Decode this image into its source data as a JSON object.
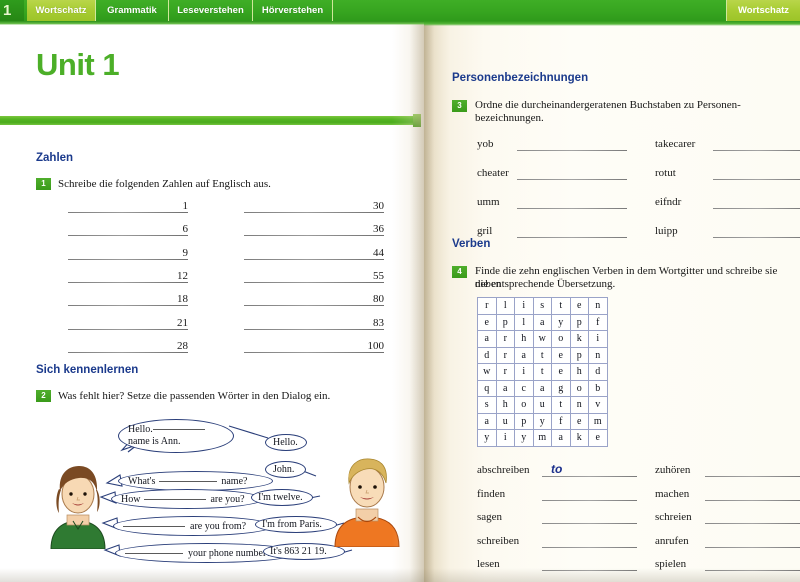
{
  "tabbar": {
    "unit_number": "1",
    "tabs": [
      {
        "label": "Wortschatz",
        "active": true
      },
      {
        "label": "Grammatik",
        "active": false
      },
      {
        "label": "Leseverstehen",
        "active": false
      },
      {
        "label": "Hörverstehen",
        "active": false
      },
      {
        "label": "",
        "active": false
      }
    ],
    "right_tab": "Wortschatz"
  },
  "left_page": {
    "unit_title": "Unit 1",
    "sections": [
      {
        "heading": "Zahlen",
        "exercise_number": "1",
        "instruction": "Schreibe die folgenden Zahlen auf Englisch aus.",
        "numbers_left": [
          "1",
          "6",
          "9",
          "12",
          "18",
          "21",
          "28"
        ],
        "numbers_right": [
          "30",
          "36",
          "44",
          "55",
          "80",
          "83",
          "100"
        ]
      },
      {
        "heading": "Sich kennenlernen",
        "exercise_number": "2",
        "instruction": "Was fehlt hier? Setze die passenden Wörter in den Dialog ein."
      }
    ],
    "dialogue": {
      "bubbles": [
        {
          "id": "b1",
          "speaker": "girl",
          "text_before": "Hello.",
          "text_line2_before": "",
          "text_after": "name is Ann."
        },
        {
          "id": "b2",
          "speaker": "boy",
          "text_before": "Hello."
        },
        {
          "id": "b3",
          "speaker": "boy",
          "text_before": "John."
        },
        {
          "id": "b4",
          "speaker": "girl",
          "text_before": "What's",
          "text_after": "name?"
        },
        {
          "id": "b5",
          "speaker": "girl",
          "text_before": "How",
          "text_after": "are you?"
        },
        {
          "id": "b6",
          "speaker": "boy",
          "text_before": "I'm twelve."
        },
        {
          "id": "b7",
          "speaker": "girl",
          "text_before": "",
          "text_after": "are you from?"
        },
        {
          "id": "b8",
          "speaker": "boy",
          "text_before": "I'm from Paris."
        },
        {
          "id": "b9",
          "speaker": "girl",
          "text_before": "",
          "text_after": "your phone number?"
        },
        {
          "id": "b10",
          "speaker": "boy",
          "text_before": "It's 863 21 19."
        }
      ],
      "characters": [
        {
          "name": "girl-ann",
          "shirt_color": "#2f7a32",
          "hair_color": "#7a4a23"
        },
        {
          "name": "boy-john",
          "shirt_color": "#ee7722",
          "hair_color": "#d8b45c"
        }
      ]
    }
  },
  "right_page": {
    "sections": [
      {
        "heading": "Personenbezeichnungen",
        "exercise_number": "3",
        "instruction_line1": "Ordne die durcheinandergeratenen Buchstaben zu Personen-",
        "instruction_line2": "bezeichnungen.",
        "words_left": [
          "yob",
          "cheater",
          "umm",
          "gril"
        ],
        "words_right": [
          "takecarer",
          "rotut",
          "eifndr",
          "luipp"
        ]
      },
      {
        "heading": "Verben",
        "exercise_number": "4",
        "instruction_line1": "Finde die zehn englischen Verben in dem Wortgitter und schreibe sie neben",
        "instruction_line2": "die entsprechende Übersetzung.",
        "letter_grid": [
          [
            "r",
            "l",
            "i",
            "s",
            "t",
            "e",
            "n"
          ],
          [
            "e",
            "p",
            "l",
            "a",
            "y",
            "p",
            "f"
          ],
          [
            "a",
            "r",
            "h",
            "w",
            "o",
            "k",
            "i"
          ],
          [
            "d",
            "r",
            "a",
            "t",
            "e",
            "p",
            "n"
          ],
          [
            "w",
            "r",
            "i",
            "t",
            "e",
            "h",
            "d"
          ],
          [
            "q",
            "a",
            "c",
            "a",
            "g",
            "o",
            "b"
          ],
          [
            "s",
            "h",
            "o",
            "u",
            "t",
            "n",
            "v"
          ],
          [
            "a",
            "u",
            "p",
            "y",
            "f",
            "e",
            "m"
          ],
          [
            "y",
            "i",
            "y",
            "m",
            "a",
            "k",
            "e"
          ]
        ],
        "verbs_left": [
          "abschreiben",
          "finden",
          "sagen",
          "schreiben",
          "lesen"
        ],
        "verbs_right": [
          "zuhören",
          "machen",
          "schreien",
          "anrufen",
          "spielen"
        ],
        "answer_handwritten": "to"
      }
    ]
  },
  "colors": {
    "brand_green": "#4caf28",
    "tab_green": "#37a520",
    "tab_active": "#a8cc33",
    "heading_blue": "#1b3a8c",
    "badge_green": "#4fae2c",
    "paper": "#fdfcf6"
  }
}
